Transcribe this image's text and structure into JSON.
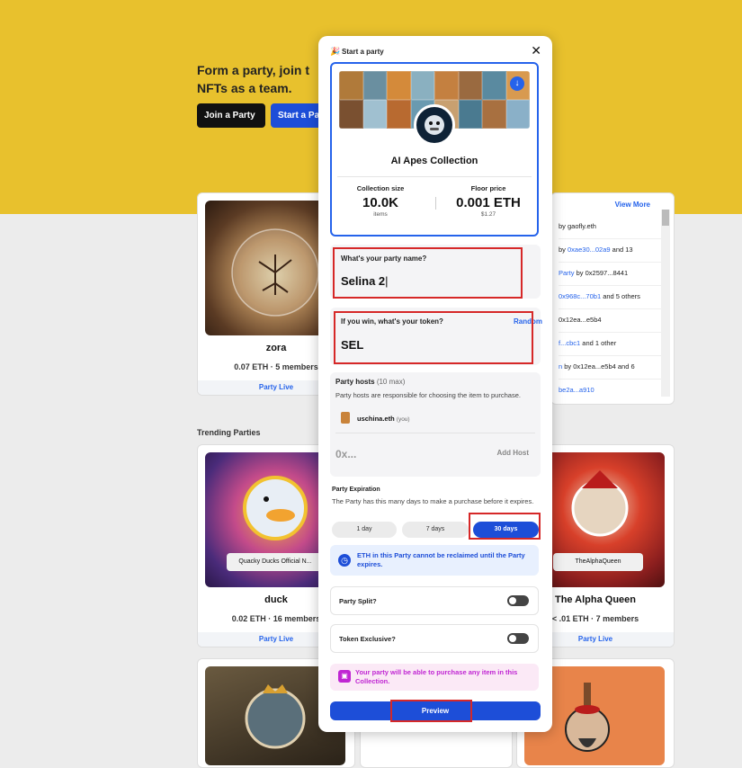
{
  "hero": {
    "text_line1": "Form a party, join t",
    "text_line2": "NFTs as a team.",
    "join_label": "Join a Party",
    "start_label": "Start a Pa"
  },
  "cards": [
    {
      "name": "zora",
      "meta": "0.07 ETH · 5 members",
      "status": "Party Live"
    },
    {
      "name": "duck",
      "meta": "0.02 ETH · 16 members",
      "status": "Party Live",
      "badge": "Quacky Ducks Official N..."
    },
    {
      "name": "The Alpha Queen",
      "meta": "< .01 ETH · 7 members",
      "status": "Party Live",
      "badge": "TheAlphaQueen"
    }
  ],
  "activity": {
    "view_more": "View More",
    "rows": [
      {
        "pre": "by gaofly.eth",
        "link": "",
        "post": ""
      },
      {
        "pre": "by ",
        "link": "0xae30...02a9",
        "post": " and 13"
      },
      {
        "pre": "",
        "link": "Party",
        "post": " by 0x2597...8441"
      },
      {
        "pre": "",
        "link": "0x968c...70b1",
        "post": " and 5 others"
      },
      {
        "pre": "0x12ea...e5b4",
        "link": "",
        "post": ""
      },
      {
        "pre": "",
        "link": "f...cbc1",
        "post": " and 1 other"
      },
      {
        "pre": "",
        "link": "n",
        "post": " by 0x12ea...e5b4 and 6"
      },
      {
        "pre": "",
        "link": "be2a...a910",
        "post": ""
      }
    ]
  },
  "trending_label": "Trending Parties",
  "modal": {
    "title": "Start a party",
    "collection": {
      "name": "AI Apes Collection",
      "size_label": "Collection size",
      "size_value": "10.0K",
      "size_sub": "items",
      "floor_label": "Floor price",
      "floor_value": "0.001 ETH",
      "floor_sub": "$1.27"
    },
    "party_name_label": "What's your party name?",
    "party_name_value": "Selina 2",
    "token_label": "If you win, what's your token?",
    "token_random": "Random",
    "token_value": "SEL",
    "hosts_label": "Party hosts",
    "hosts_max": "(10 max)",
    "hosts_desc": "Party hosts are responsible for choosing the item to purchase.",
    "host_name": "uschina.eth",
    "host_you": "(you)",
    "host_placeholder": "0x...",
    "add_host": "Add Host",
    "expiration_label": "Party Expiration",
    "expiration_desc": "The Party has this many days to make a purchase before it expires.",
    "durations": [
      "1 day",
      "7 days",
      "30 days"
    ],
    "info_text": "ETH in this Party cannot be reclaimed until the Party expires.",
    "split_label": "Party Split?",
    "exclusive_label": "Token Exclusive?",
    "pink_text": "Your party will be able to purchase any item in this Collection.",
    "preview_label": "Preview"
  },
  "colors": {
    "accent": "#1d4ed8",
    "hero": "#e8c12d",
    "highlight": "#d62828",
    "pink": "#c026d3"
  }
}
